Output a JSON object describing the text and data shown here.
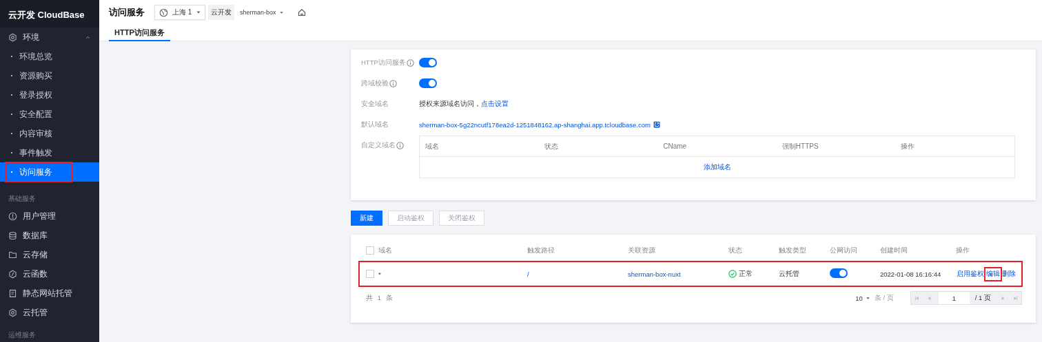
{
  "sidebar": {
    "brand": "云开发 CloudBase",
    "groups": [
      {
        "label": "环境",
        "expanded": true,
        "children": [
          {
            "label": "环境总览",
            "selected": false,
            "highlighted": false
          },
          {
            "label": "资源购买",
            "selected": false,
            "highlighted": false
          },
          {
            "label": "登录授权",
            "selected": false,
            "highlighted": false
          },
          {
            "label": "安全配置",
            "selected": false,
            "highlighted": false
          },
          {
            "label": "内容审核",
            "selected": false,
            "highlighted": false
          },
          {
            "label": "事件触发",
            "selected": false,
            "highlighted": false
          },
          {
            "label": "访问服务",
            "selected": true,
            "highlighted": true
          }
        ]
      }
    ],
    "sections": [
      {
        "label": "基础服务",
        "items": [
          {
            "label": "用户管理",
            "selected": false
          },
          {
            "label": "数据库",
            "selected": false
          },
          {
            "label": "云存储",
            "selected": false
          },
          {
            "label": "云函数",
            "selected": false
          },
          {
            "label": "静态网站托管",
            "selected": false
          },
          {
            "label": "云托管",
            "selected": false
          }
        ]
      },
      {
        "label": "运维服务"
      }
    ]
  },
  "header": {
    "title": "访问服务",
    "region": "上海 1",
    "product": "云开发",
    "environment": "sherman-box"
  },
  "tabs": [
    {
      "label": "HTTP访问服务",
      "selected": true
    }
  ],
  "settings": {
    "rows": [
      {
        "kind": "toggle",
        "label": "HTTP访问服务",
        "info": true,
        "on": true
      },
      {
        "kind": "toggle",
        "label": "跨域校验",
        "info": true,
        "on": true
      },
      {
        "kind": "text",
        "label": "安全域名",
        "info": false,
        "text": "授权来源域名访问，",
        "link": "点击设置"
      },
      {
        "kind": "link",
        "label": "默认域名",
        "info": false,
        "link": "sherman-box-5g22ncutf178ea2d-1251848162.ap-shanghai.app.tcloudbase.com"
      },
      {
        "kind": "table",
        "label": "自定义域名",
        "info": true,
        "columns": [
          "域名",
          "状态",
          "CName",
          "强制HTTPS",
          "操作"
        ],
        "empty_action": "添加域名"
      }
    ]
  },
  "toolbar": [
    {
      "label": "新建",
      "disabled": false,
      "primary": true
    },
    {
      "label": "启动鉴权",
      "disabled": true,
      "primary": false
    },
    {
      "label": "关闭鉴权",
      "disabled": true,
      "primary": false
    }
  ],
  "table": {
    "select_all_checked": false,
    "columns": [
      "域名",
      "触发路径",
      "关联资源",
      "状态",
      "触发类型",
      "公网访问",
      "创建时间",
      "操作"
    ],
    "rows": [
      {
        "checked": false,
        "highlighted": true,
        "domain": "*",
        "path": "/",
        "resource": "sherman-box-nuxt",
        "status": "正常",
        "trigger_type": "云托管",
        "public_access": true,
        "created": "2022-01-08 16:16:44",
        "actions": [
          {
            "label": "启用鉴权",
            "highlighted": false
          },
          {
            "label": "编辑",
            "highlighted": true
          },
          {
            "label": "删除",
            "highlighted": false
          }
        ]
      }
    ],
    "total": "共 1 条",
    "page_size": "10",
    "page_size_unit": "条 / 页",
    "page": "1",
    "page_count": "/ 1 页"
  }
}
